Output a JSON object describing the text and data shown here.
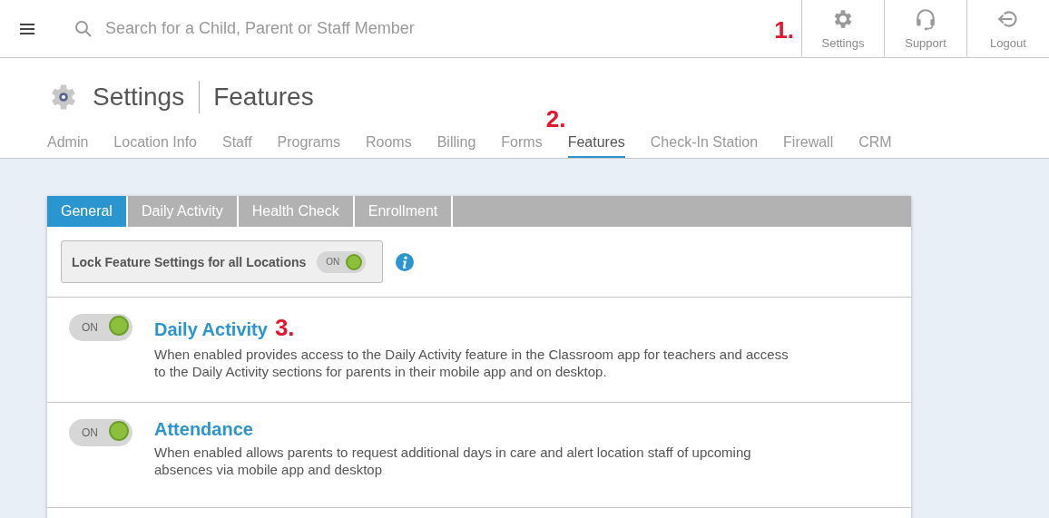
{
  "topbar": {
    "search": {
      "placeholder": "Search for a Child, Parent or Staff Member"
    },
    "marker": "1.",
    "actions": [
      {
        "label": "Settings",
        "kind": "gear"
      },
      {
        "label": "Support",
        "kind": "headset"
      },
      {
        "label": "Logout",
        "kind": "logout"
      }
    ]
  },
  "page": {
    "title": "Settings",
    "subtitle": "Features"
  },
  "nav": [
    {
      "label": "Admin",
      "selected": false
    },
    {
      "label": "Location Info",
      "selected": false
    },
    {
      "label": "Staff",
      "selected": false
    },
    {
      "label": "Programs",
      "selected": false
    },
    {
      "label": "Rooms",
      "selected": false
    },
    {
      "label": "Billing",
      "selected": false
    },
    {
      "label": "Forms",
      "selected": false
    },
    {
      "label": "Features",
      "selected": true,
      "marker": "2."
    },
    {
      "label": "Check-In Station",
      "selected": false
    },
    {
      "label": "Firewall",
      "selected": false
    },
    {
      "label": "CRM",
      "selected": false
    }
  ],
  "tabs": [
    {
      "label": "General",
      "selected": true
    },
    {
      "label": "Daily Activity",
      "selected": false
    },
    {
      "label": "Health Check",
      "selected": false
    },
    {
      "label": "Enrollment",
      "selected": false
    }
  ],
  "lock": {
    "label": "Lock Feature Settings for all Locations",
    "toggle": {
      "label": "ON",
      "on": true
    }
  },
  "features": [
    {
      "title": "Daily Activity",
      "marker": "3.",
      "toggle": {
        "label": "ON",
        "on": true
      },
      "description": "When enabled provides access to the Daily Activity feature in the Classroom app for teachers and access to the Daily Activity sections for parents in their mobile app and on desktop."
    },
    {
      "title": "Attendance",
      "toggle": {
        "label": "ON",
        "on": true
      },
      "description": "When enabled allows parents to request additional days in care and alert location staff of upcoming absences via mobile app and desktop"
    }
  ]
}
